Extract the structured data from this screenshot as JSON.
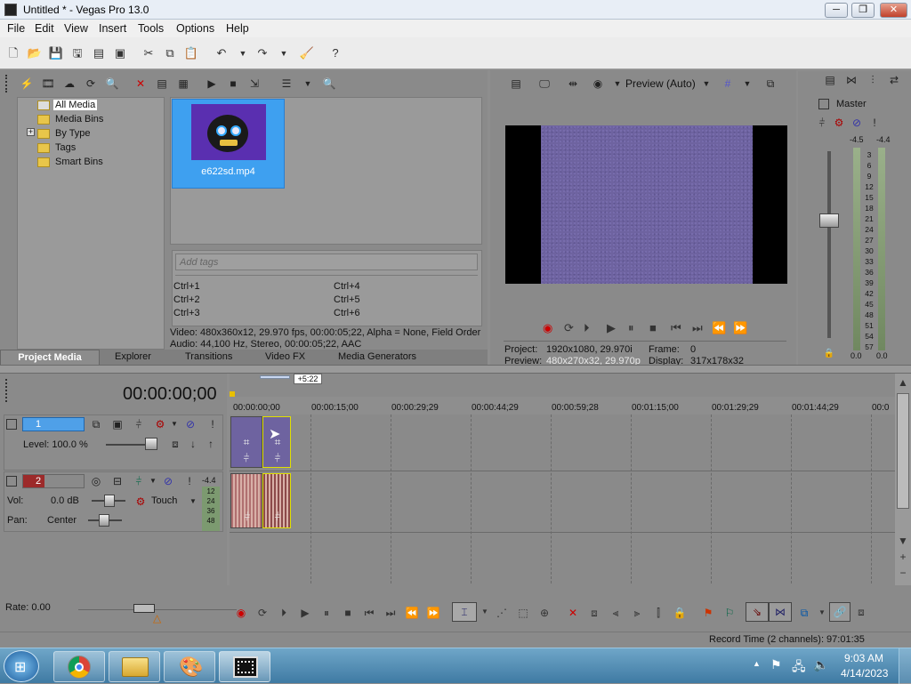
{
  "window": {
    "title": "Untitled * - Vegas Pro 13.0"
  },
  "menu": [
    "File",
    "Edit",
    "View",
    "Insert",
    "Tools",
    "Options",
    "Help"
  ],
  "media_tree": {
    "items": [
      "All Media",
      "Media Bins",
      "By Type",
      "Tags",
      "Smart Bins"
    ],
    "expander": "+"
  },
  "media": {
    "file_name": "e622sd.mp4",
    "tags_placeholder": "Add tags",
    "shortcuts_left": [
      "Ctrl+1",
      "Ctrl+2",
      "Ctrl+3"
    ],
    "shortcuts_right": [
      "Ctrl+4",
      "Ctrl+5",
      "Ctrl+6"
    ],
    "video_info": "Video: 480x360x12, 29.970 fps, 00:00:05;22, Alpha = None, Field Order",
    "audio_info": "Audio: 44,100 Hz, Stereo, 00:00:05;22, AAC"
  },
  "tabs": [
    "Project Media",
    "Explorer",
    "Transitions",
    "Video FX",
    "Media Generators"
  ],
  "preview": {
    "mode": "Preview (Auto)",
    "project_label": "Project:",
    "project_value": "1920x1080, 29.970i",
    "frame_label": "Frame:",
    "frame_value": "0",
    "preview_label": "Preview:",
    "preview_value": "480x270x32, 29.970p",
    "display_label": "Display:",
    "display_value": "317x178x32"
  },
  "mixer": {
    "title": "Master",
    "peak_left": "-4.5",
    "peak_right": "-4.4",
    "scale": [
      "3",
      "6",
      "9",
      "12",
      "15",
      "18",
      "21",
      "24",
      "27",
      "30",
      "33",
      "36",
      "39",
      "42",
      "45",
      "48",
      "51",
      "54",
      "57"
    ],
    "bottom_left": "0.0",
    "bottom_right": "0.0"
  },
  "timeline": {
    "timecode": "00:00:00;00",
    "cursor_label": "+5:22",
    "ruler": [
      "00:00:00;00",
      "00:00:15;00",
      "00:00:29;29",
      "00:00:44;29",
      "00:00:59;28",
      "00:01:15;00",
      "00:01:29;29",
      "00:01:44;29",
      "00:0"
    ]
  },
  "track_video": {
    "number": "1",
    "level": "Level: 100.0 %"
  },
  "track_audio": {
    "number": "2",
    "vol_label": "Vol:",
    "vol_value": "0.0 dB",
    "pan_label": "Pan:",
    "pan_value": "Center",
    "mode": "Touch",
    "meter_top": "-4.4",
    "meter_marks": [
      "12",
      "24",
      "36",
      "48"
    ]
  },
  "rate": "Rate: 0.00",
  "status": "Record Time (2 channels): 97:01:35",
  "clock": {
    "time": "9:03 AM",
    "date": "4/14/2023"
  },
  "colors": {
    "selection": "#3ea0f0",
    "video_clip": "#6e63a0",
    "audio_track": "#9c2a2a"
  }
}
